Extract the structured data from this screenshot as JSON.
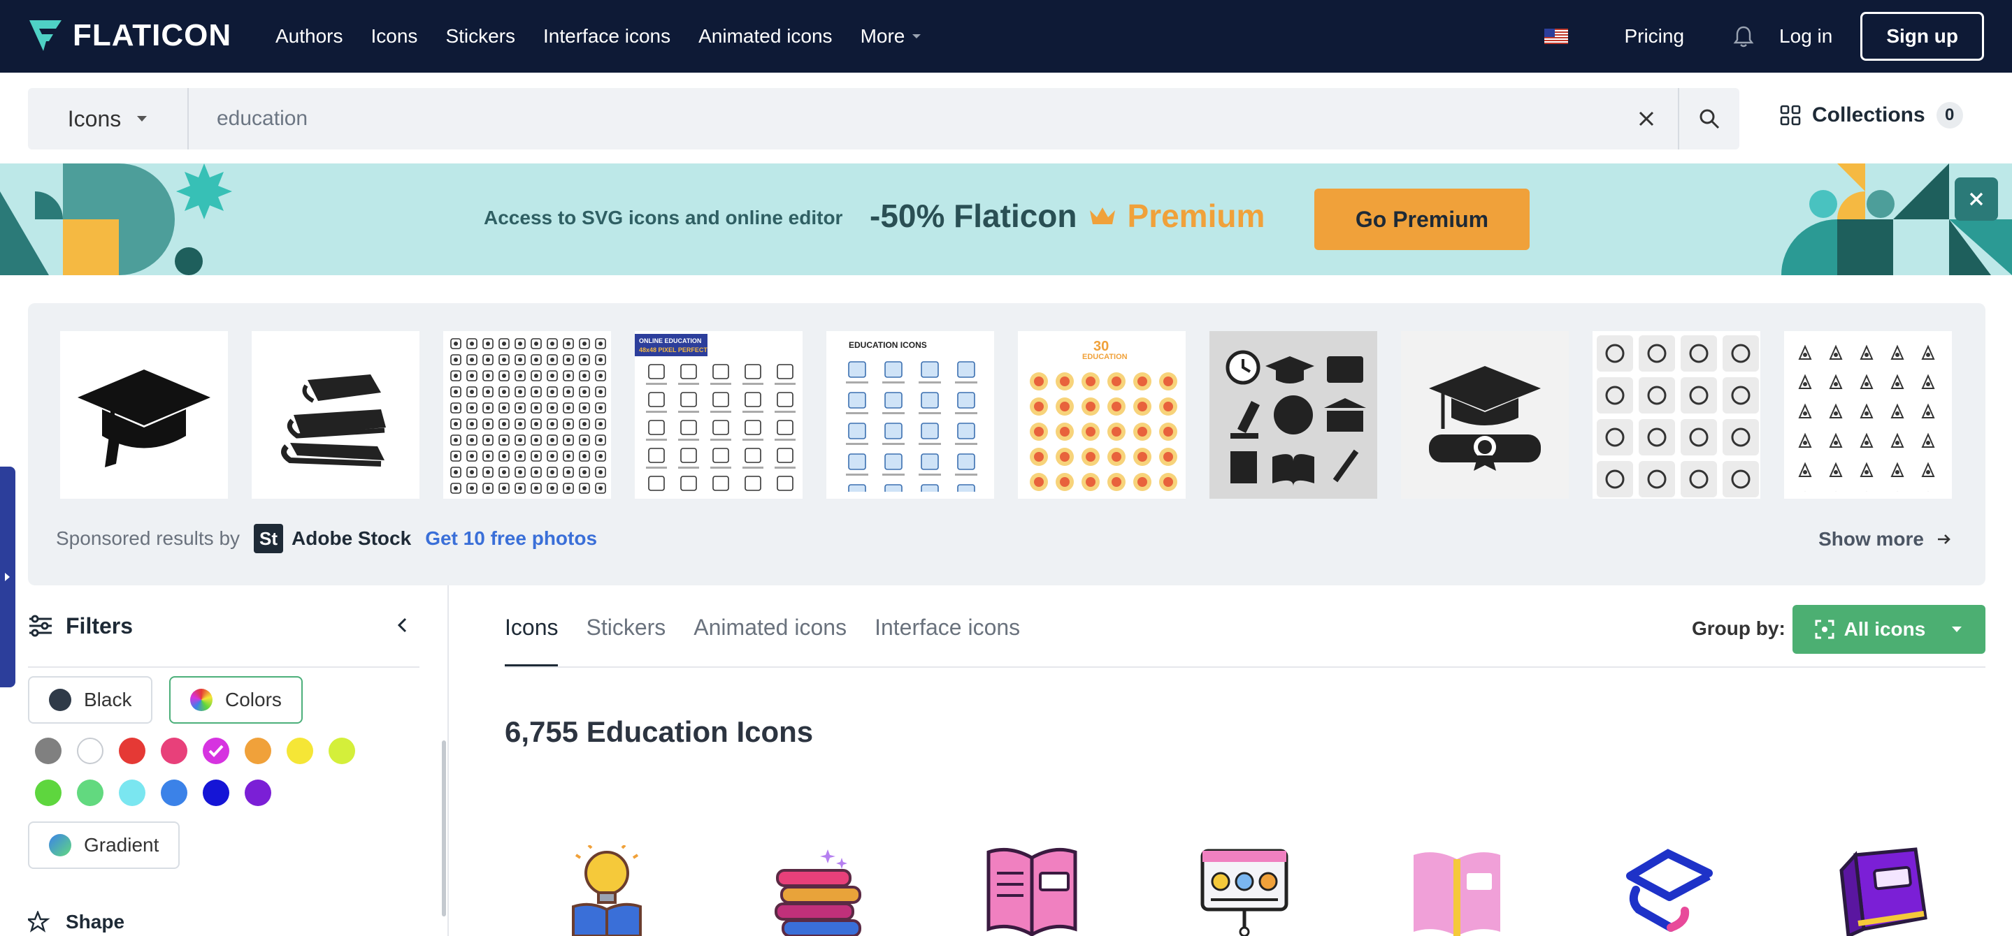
{
  "nav": {
    "brand": "FLATICON",
    "links": [
      "Authors",
      "Icons",
      "Stickers",
      "Interface icons",
      "Animated icons",
      "More"
    ],
    "pricing": "Pricing",
    "login": "Log in",
    "signup": "Sign up"
  },
  "search": {
    "type": "Icons",
    "query": "education",
    "collections_label": "Collections",
    "collections_count": "0"
  },
  "banner": {
    "text": "Access to SVG icons and online editor",
    "discount": "-50% Flaticon",
    "premium": "Premium",
    "button": "Go Premium"
  },
  "sponsored": {
    "label": "Sponsored results by",
    "provider": "Adobe Stock",
    "provider_badge": "St",
    "offer": "Get 10 free photos",
    "show_more": "Show more",
    "thumb_texts": [
      "ONLINE EDUCATION",
      "48x48 PIXEL PERFECT",
      "EDUCATION ICONS",
      "30",
      "EDUCATION"
    ]
  },
  "filters": {
    "title": "Filters",
    "black": "Black",
    "colors": "Colors",
    "gradient": "Gradient",
    "shape": "Shape",
    "swatches": [
      "#808080",
      "#ffffff",
      "#e53935",
      "#e8407a",
      "#d633e0",
      "#f0a13a",
      "#f5e636",
      "#d4ef3a",
      "#5ed63e",
      "#62d97f",
      "#7ae6f0",
      "#3b82e8",
      "#1515d6",
      "#7b1fd6"
    ],
    "selected_swatch": "#d633e0"
  },
  "main": {
    "tabs": [
      "Icons",
      "Stickers",
      "Animated icons",
      "Interface icons"
    ],
    "active_tab": "Icons",
    "group_by": "Group by:",
    "group_value": "All icons",
    "heading": "6,755 Education Icons"
  },
  "colors": {
    "nav_bg": "#0e1a36",
    "accent_green": "#4caf72",
    "premium_orange": "#f0a13a",
    "banner_bg": "#bde8e8"
  }
}
